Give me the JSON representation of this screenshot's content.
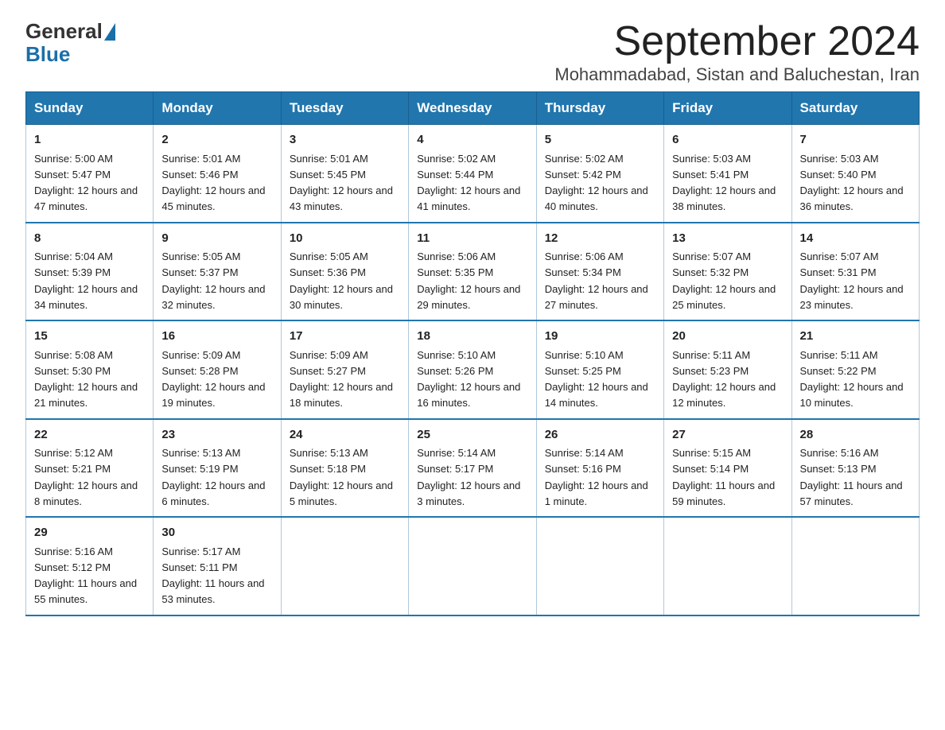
{
  "header": {
    "logo_general": "General",
    "logo_blue": "Blue",
    "month_title": "September 2024",
    "location": "Mohammadabad, Sistan and Baluchestan, Iran"
  },
  "weekdays": [
    "Sunday",
    "Monday",
    "Tuesday",
    "Wednesday",
    "Thursday",
    "Friday",
    "Saturday"
  ],
  "weeks": [
    [
      {
        "day": "1",
        "sunrise": "5:00 AM",
        "sunset": "5:47 PM",
        "daylight": "12 hours and 47 minutes."
      },
      {
        "day": "2",
        "sunrise": "5:01 AM",
        "sunset": "5:46 PM",
        "daylight": "12 hours and 45 minutes."
      },
      {
        "day": "3",
        "sunrise": "5:01 AM",
        "sunset": "5:45 PM",
        "daylight": "12 hours and 43 minutes."
      },
      {
        "day": "4",
        "sunrise": "5:02 AM",
        "sunset": "5:44 PM",
        "daylight": "12 hours and 41 minutes."
      },
      {
        "day": "5",
        "sunrise": "5:02 AM",
        "sunset": "5:42 PM",
        "daylight": "12 hours and 40 minutes."
      },
      {
        "day": "6",
        "sunrise": "5:03 AM",
        "sunset": "5:41 PM",
        "daylight": "12 hours and 38 minutes."
      },
      {
        "day": "7",
        "sunrise": "5:03 AM",
        "sunset": "5:40 PM",
        "daylight": "12 hours and 36 minutes."
      }
    ],
    [
      {
        "day": "8",
        "sunrise": "5:04 AM",
        "sunset": "5:39 PM",
        "daylight": "12 hours and 34 minutes."
      },
      {
        "day": "9",
        "sunrise": "5:05 AM",
        "sunset": "5:37 PM",
        "daylight": "12 hours and 32 minutes."
      },
      {
        "day": "10",
        "sunrise": "5:05 AM",
        "sunset": "5:36 PM",
        "daylight": "12 hours and 30 minutes."
      },
      {
        "day": "11",
        "sunrise": "5:06 AM",
        "sunset": "5:35 PM",
        "daylight": "12 hours and 29 minutes."
      },
      {
        "day": "12",
        "sunrise": "5:06 AM",
        "sunset": "5:34 PM",
        "daylight": "12 hours and 27 minutes."
      },
      {
        "day": "13",
        "sunrise": "5:07 AM",
        "sunset": "5:32 PM",
        "daylight": "12 hours and 25 minutes."
      },
      {
        "day": "14",
        "sunrise": "5:07 AM",
        "sunset": "5:31 PM",
        "daylight": "12 hours and 23 minutes."
      }
    ],
    [
      {
        "day": "15",
        "sunrise": "5:08 AM",
        "sunset": "5:30 PM",
        "daylight": "12 hours and 21 minutes."
      },
      {
        "day": "16",
        "sunrise": "5:09 AM",
        "sunset": "5:28 PM",
        "daylight": "12 hours and 19 minutes."
      },
      {
        "day": "17",
        "sunrise": "5:09 AM",
        "sunset": "5:27 PM",
        "daylight": "12 hours and 18 minutes."
      },
      {
        "day": "18",
        "sunrise": "5:10 AM",
        "sunset": "5:26 PM",
        "daylight": "12 hours and 16 minutes."
      },
      {
        "day": "19",
        "sunrise": "5:10 AM",
        "sunset": "5:25 PM",
        "daylight": "12 hours and 14 minutes."
      },
      {
        "day": "20",
        "sunrise": "5:11 AM",
        "sunset": "5:23 PM",
        "daylight": "12 hours and 12 minutes."
      },
      {
        "day": "21",
        "sunrise": "5:11 AM",
        "sunset": "5:22 PM",
        "daylight": "12 hours and 10 minutes."
      }
    ],
    [
      {
        "day": "22",
        "sunrise": "5:12 AM",
        "sunset": "5:21 PM",
        "daylight": "12 hours and 8 minutes."
      },
      {
        "day": "23",
        "sunrise": "5:13 AM",
        "sunset": "5:19 PM",
        "daylight": "12 hours and 6 minutes."
      },
      {
        "day": "24",
        "sunrise": "5:13 AM",
        "sunset": "5:18 PM",
        "daylight": "12 hours and 5 minutes."
      },
      {
        "day": "25",
        "sunrise": "5:14 AM",
        "sunset": "5:17 PM",
        "daylight": "12 hours and 3 minutes."
      },
      {
        "day": "26",
        "sunrise": "5:14 AM",
        "sunset": "5:16 PM",
        "daylight": "12 hours and 1 minute."
      },
      {
        "day": "27",
        "sunrise": "5:15 AM",
        "sunset": "5:14 PM",
        "daylight": "11 hours and 59 minutes."
      },
      {
        "day": "28",
        "sunrise": "5:16 AM",
        "sunset": "5:13 PM",
        "daylight": "11 hours and 57 minutes."
      }
    ],
    [
      {
        "day": "29",
        "sunrise": "5:16 AM",
        "sunset": "5:12 PM",
        "daylight": "11 hours and 55 minutes."
      },
      {
        "day": "30",
        "sunrise": "5:17 AM",
        "sunset": "5:11 PM",
        "daylight": "11 hours and 53 minutes."
      },
      null,
      null,
      null,
      null,
      null
    ]
  ]
}
